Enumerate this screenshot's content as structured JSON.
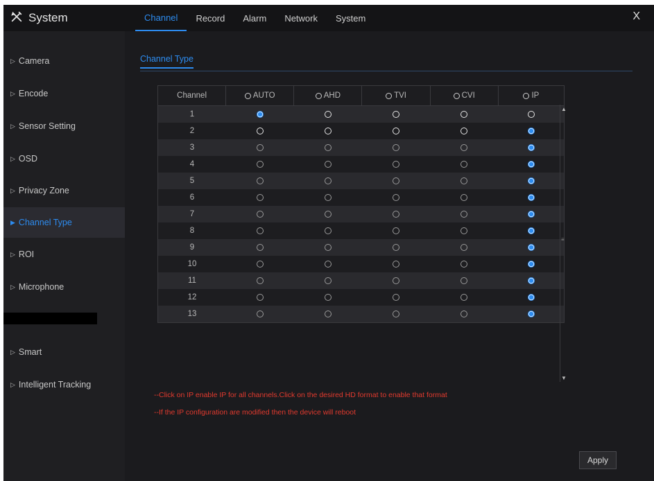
{
  "header": {
    "title": "System",
    "tabs": [
      {
        "label": "Channel",
        "active": true
      },
      {
        "label": "Record",
        "active": false
      },
      {
        "label": "Alarm",
        "active": false
      },
      {
        "label": "Network",
        "active": false
      },
      {
        "label": "System",
        "active": false
      }
    ],
    "close_label": "X"
  },
  "sidebar": {
    "items": [
      {
        "label": "Camera",
        "active": false
      },
      {
        "label": "Encode",
        "active": false
      },
      {
        "label": "Sensor Setting",
        "active": false
      },
      {
        "label": "OSD",
        "active": false
      },
      {
        "label": "Privacy Zone",
        "active": false
      },
      {
        "label": "Channel Type",
        "active": true
      },
      {
        "label": "ROI",
        "active": false
      },
      {
        "label": "Microphone",
        "active": false
      },
      {
        "label": "Smart",
        "active": false
      },
      {
        "label": "Intelligent Tracking",
        "active": false
      }
    ]
  },
  "main": {
    "subtab": "Channel Type",
    "table": {
      "headers": [
        "Channel",
        "AUTO",
        "AHD",
        "TVI",
        "CVI",
        "IP"
      ],
      "rows": [
        {
          "channel": "1",
          "selected": "AUTO"
        },
        {
          "channel": "2",
          "selected": "IP"
        },
        {
          "channel": "3",
          "selected": "IP"
        },
        {
          "channel": "4",
          "selected": "IP"
        },
        {
          "channel": "5",
          "selected": "IP"
        },
        {
          "channel": "6",
          "selected": "IP"
        },
        {
          "channel": "7",
          "selected": "IP"
        },
        {
          "channel": "8",
          "selected": "IP"
        },
        {
          "channel": "9",
          "selected": "IP"
        },
        {
          "channel": "10",
          "selected": "IP"
        },
        {
          "channel": "11",
          "selected": "IP"
        },
        {
          "channel": "12",
          "selected": "IP"
        },
        {
          "channel": "13",
          "selected": "IP"
        }
      ]
    },
    "notes": [
      "--Click on IP enable IP for all channels.Click on the desired HD format to enable that format",
      "--If the IP configuration are modified then the device will reboot"
    ],
    "apply_label": "Apply"
  },
  "colors": {
    "accent": "#2d8cf0",
    "background": "#1b1b1e",
    "note": "#e23a2e"
  }
}
